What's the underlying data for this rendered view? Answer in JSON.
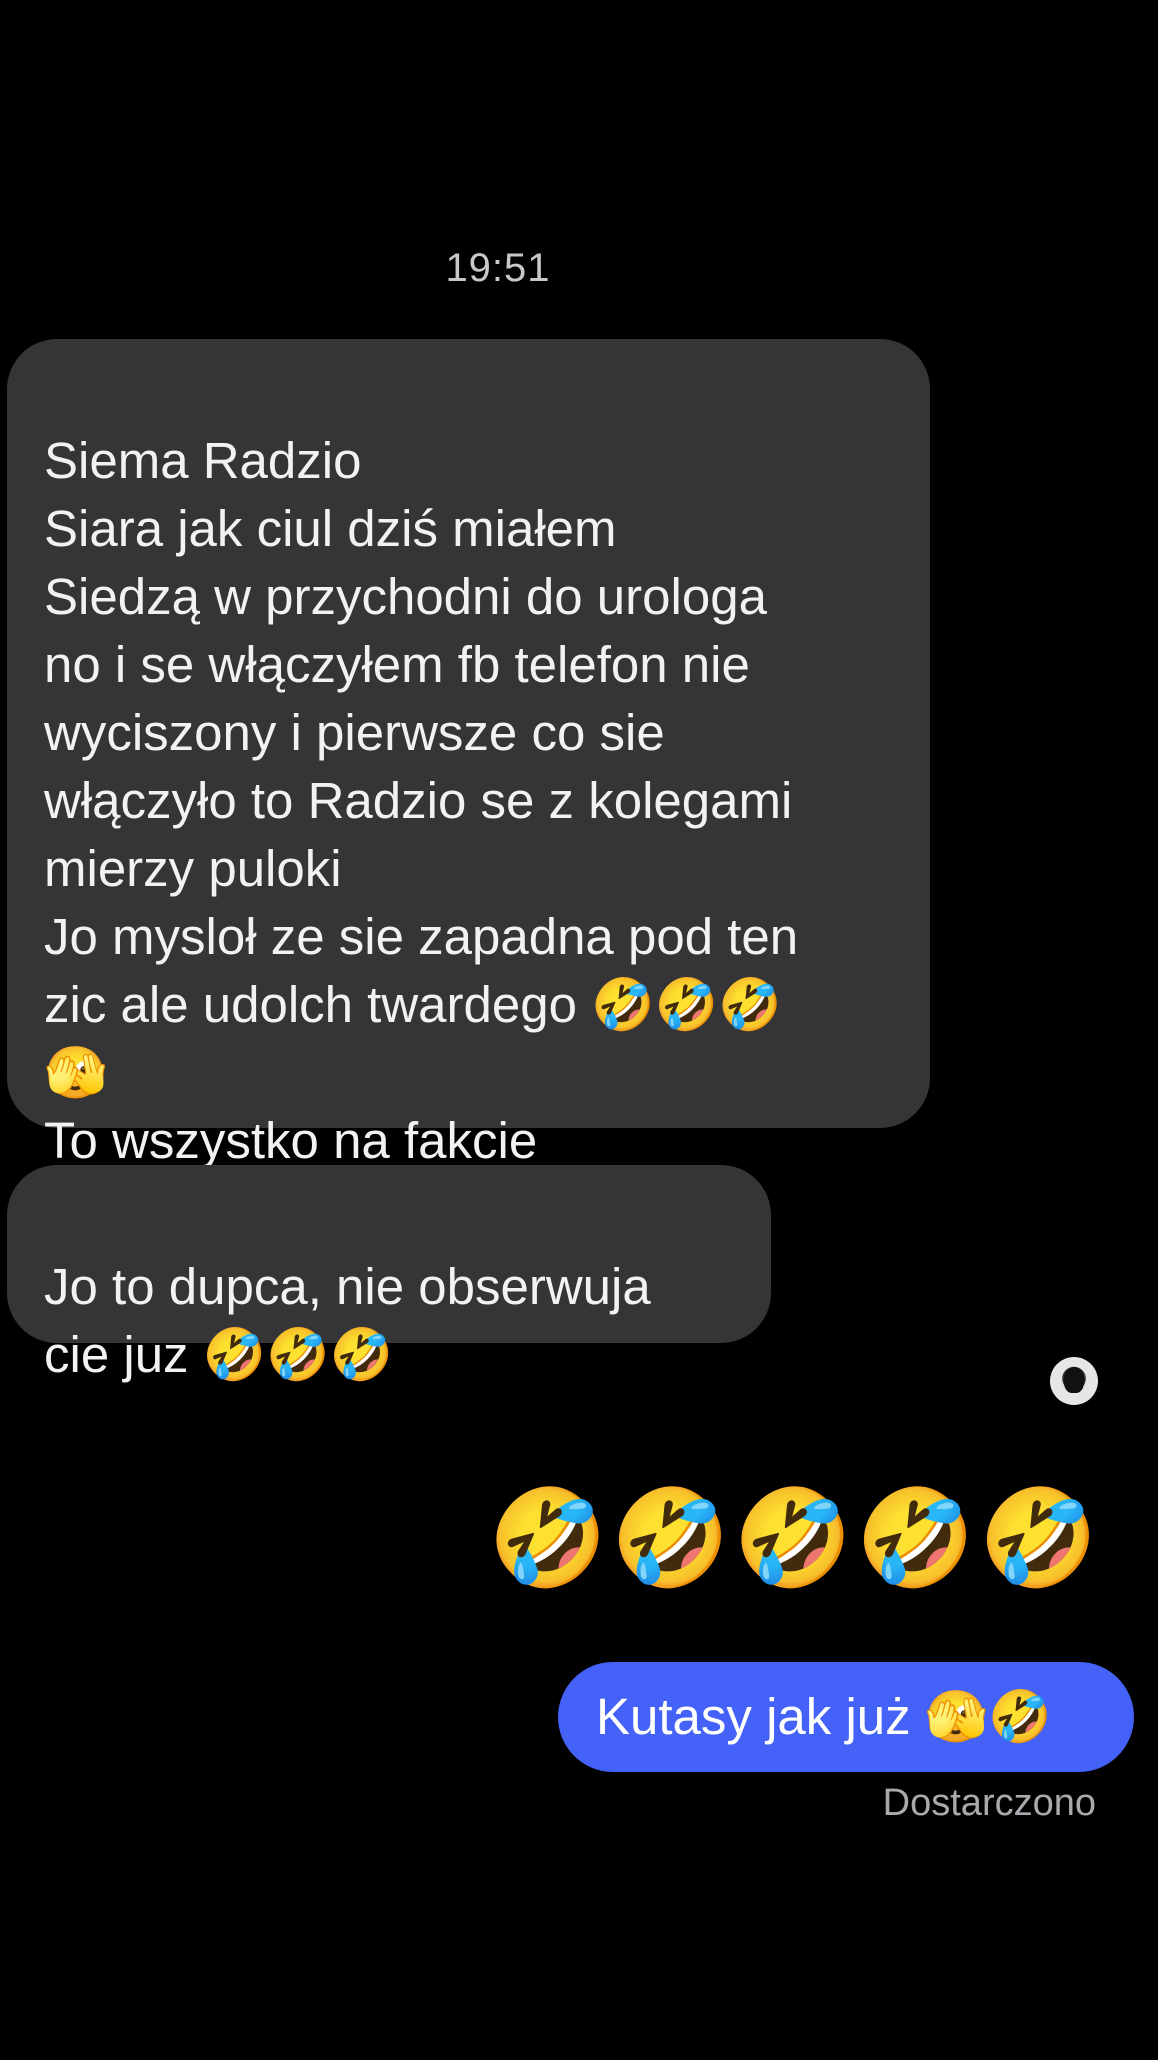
{
  "conversation": {
    "timestamp": "19:51",
    "messages": [
      {
        "direction": "incoming",
        "text": "Siema Radzio\nSiara jak ciul dziś miałem\nSiedzą w przychodni do urologa\nno i se włączyłem fb telefon nie\nwyciszony i pierwsze co sie\nwłączyło to Radzio se z kolegami\nmierzy puloki\nJo mysloł ze sie zapadna pod ten\nzic ale udolch twardego 🤣🤣🤣\n🫣\nTo wszystko na fakcie"
      },
      {
        "direction": "incoming",
        "text": "Jo to dupca, nie obserwuja\ncie juz 🤣🤣🤣"
      },
      {
        "direction": "outgoing",
        "emojis": [
          "🤣",
          "🤣",
          "🤣",
          "🤣",
          "🤣"
        ]
      },
      {
        "direction": "outgoing",
        "text": "Kutasy jak już 🫣🤣"
      }
    ],
    "delivery_status": "Dostarczono"
  },
  "colors": {
    "background": "#000000",
    "incoming_bubble": "#353537",
    "outgoing_bubble": "#4462f7",
    "status_text": "#a9a9ae"
  },
  "icons": {
    "avatar": "read-receipt-avatar"
  }
}
